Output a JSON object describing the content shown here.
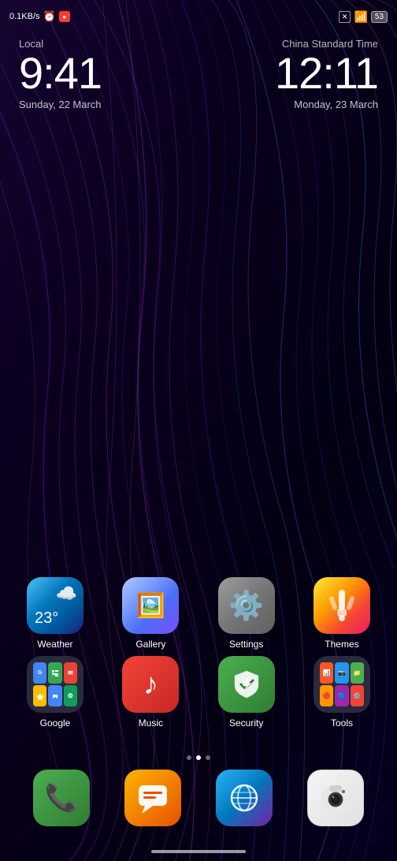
{
  "statusBar": {
    "speed": "0.1KB/s",
    "battery": "53",
    "time_local_label": "Local",
    "time_local": "9:41",
    "date_local": "Sunday, 22 March",
    "time_china_label": "China Standard Time",
    "time_china": "12:11",
    "date_china": "Monday, 23 March"
  },
  "apps": {
    "row1": [
      {
        "id": "weather",
        "label": "Weather",
        "icon": "weather"
      },
      {
        "id": "gallery",
        "label": "Gallery",
        "icon": "gallery"
      },
      {
        "id": "settings",
        "label": "Settings",
        "icon": "settings"
      },
      {
        "id": "themes",
        "label": "Themes",
        "icon": "themes"
      }
    ],
    "row2": [
      {
        "id": "google",
        "label": "Google",
        "icon": "google"
      },
      {
        "id": "music",
        "label": "Music",
        "icon": "music"
      },
      {
        "id": "security",
        "label": "Security",
        "icon": "security"
      },
      {
        "id": "tools",
        "label": "Tools",
        "icon": "tools"
      }
    ]
  },
  "dock": [
    {
      "id": "phone",
      "icon": "phone"
    },
    {
      "id": "messages",
      "icon": "messages"
    },
    {
      "id": "browser",
      "icon": "browser"
    },
    {
      "id": "camera",
      "icon": "camera"
    }
  ],
  "pageIndicators": {
    "count": 3,
    "active": 1
  },
  "weather": {
    "temp": "23°"
  }
}
